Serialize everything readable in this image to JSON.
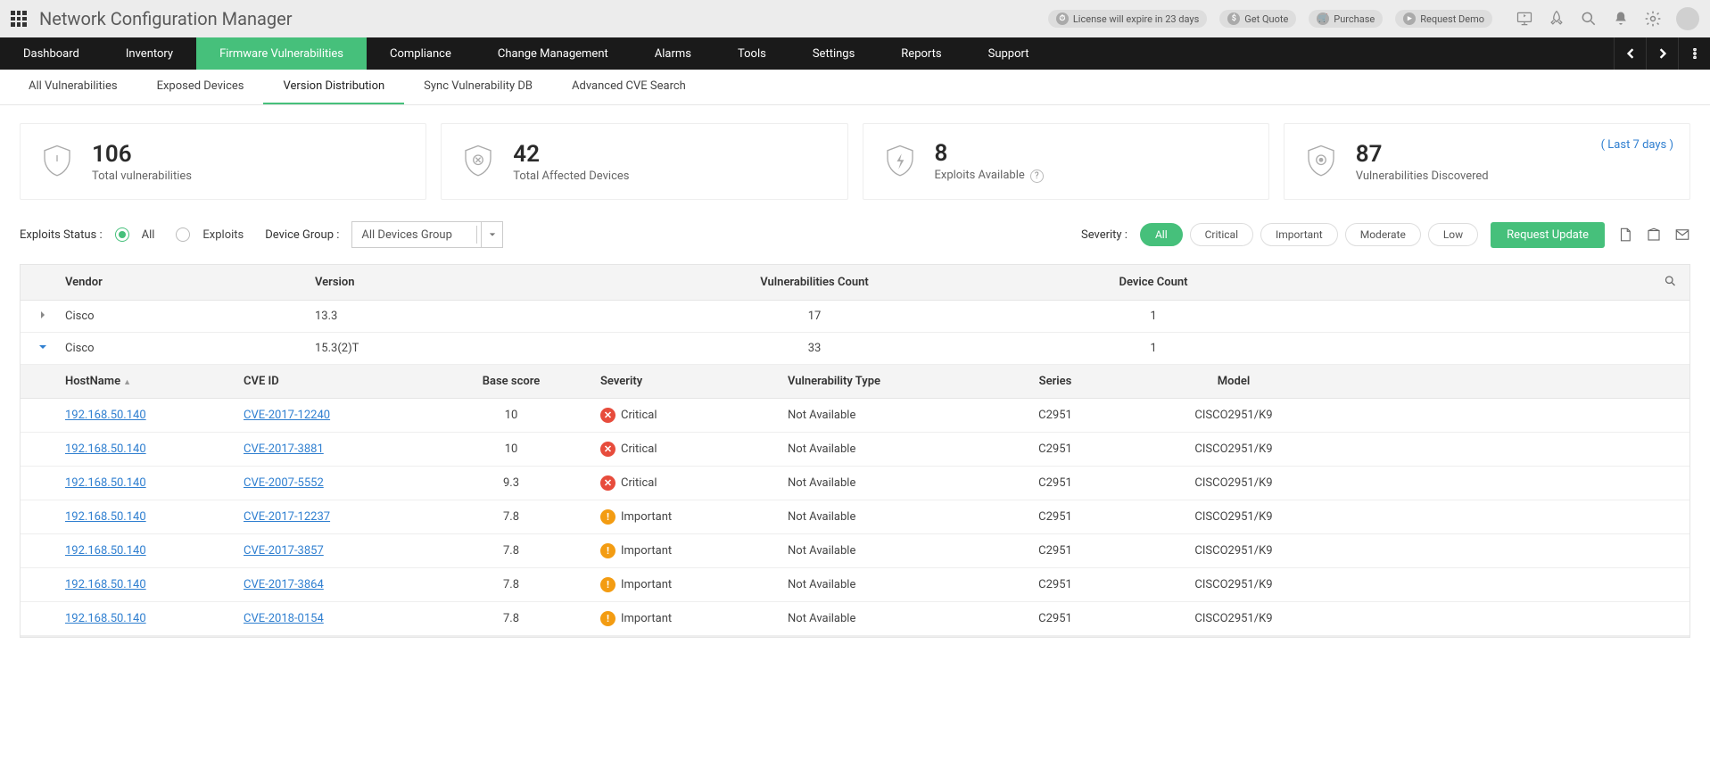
{
  "header": {
    "product_title": "Network Configuration Manager",
    "license_text": "License will expire in 23 days",
    "get_quote": "Get Quote",
    "purchase": "Purchase",
    "request_demo": "Request Demo"
  },
  "mainnav": [
    "Dashboard",
    "Inventory",
    "Firmware Vulnerabilities",
    "Compliance",
    "Change Management",
    "Alarms",
    "Tools",
    "Settings",
    "Reports",
    "Support"
  ],
  "mainnav_active": 2,
  "subnav": [
    "All Vulnerabilities",
    "Exposed Devices",
    "Version Distribution",
    "Sync Vulnerability DB",
    "Advanced CVE Search"
  ],
  "subnav_active": 2,
  "cards": [
    {
      "value": "106",
      "label": "Total vulnerabilities",
      "icon": "shield-warning"
    },
    {
      "value": "42",
      "label": "Total Affected Devices",
      "icon": "shield-x"
    },
    {
      "value": "8",
      "label": "Exploits Available",
      "icon": "shield-bolt",
      "help": true
    },
    {
      "value": "87",
      "label": "Vulnerabilities Discovered",
      "icon": "shield-target",
      "link": "( Last 7 days )"
    }
  ],
  "filters": {
    "exploits_label": "Exploits Status :",
    "radio_all": "All",
    "radio_exploits": "Exploits",
    "device_group_label": "Device Group :",
    "device_group_value": "All Devices Group",
    "severity_label": "Severity :",
    "severity_options": [
      "All",
      "Critical",
      "Important",
      "Moderate",
      "Low"
    ],
    "severity_active": 0,
    "request_update": "Request Update"
  },
  "table": {
    "headers": {
      "vendor": "Vendor",
      "version": "Version",
      "vcount": "Vulnerabilities Count",
      "dcount": "Device Count"
    },
    "rows": [
      {
        "vendor": "Cisco",
        "version": "13.3",
        "vcount": "17",
        "dcount": "1",
        "expanded": false
      },
      {
        "vendor": "Cisco",
        "version": "15.3(2)T",
        "vcount": "33",
        "dcount": "1",
        "expanded": true
      }
    ],
    "sub_headers": {
      "host": "HostName",
      "cve": "CVE ID",
      "score": "Base score",
      "sev": "Severity",
      "type": "Vulnerability Type",
      "series": "Series",
      "model": "Model"
    },
    "sub_rows": [
      {
        "host": "192.168.50.140",
        "cve": "CVE-2017-12240",
        "score": "10",
        "sev": "Critical",
        "type": "Not Available",
        "series": "C2951",
        "model": "CISCO2951/K9"
      },
      {
        "host": "192.168.50.140",
        "cve": "CVE-2017-3881",
        "score": "10",
        "sev": "Critical",
        "type": "Not Available",
        "series": "C2951",
        "model": "CISCO2951/K9"
      },
      {
        "host": "192.168.50.140",
        "cve": "CVE-2007-5552",
        "score": "9.3",
        "sev": "Critical",
        "type": "Not Available",
        "series": "C2951",
        "model": "CISCO2951/K9"
      },
      {
        "host": "192.168.50.140",
        "cve": "CVE-2017-12237",
        "score": "7.8",
        "sev": "Important",
        "type": "Not Available",
        "series": "C2951",
        "model": "CISCO2951/K9"
      },
      {
        "host": "192.168.50.140",
        "cve": "CVE-2017-3857",
        "score": "7.8",
        "sev": "Important",
        "type": "Not Available",
        "series": "C2951",
        "model": "CISCO2951/K9"
      },
      {
        "host": "192.168.50.140",
        "cve": "CVE-2017-3864",
        "score": "7.8",
        "sev": "Important",
        "type": "Not Available",
        "series": "C2951",
        "model": "CISCO2951/K9"
      },
      {
        "host": "192.168.50.140",
        "cve": "CVE-2018-0154",
        "score": "7.8",
        "sev": "Important",
        "type": "Not Available",
        "series": "C2951",
        "model": "CISCO2951/K9"
      }
    ]
  }
}
